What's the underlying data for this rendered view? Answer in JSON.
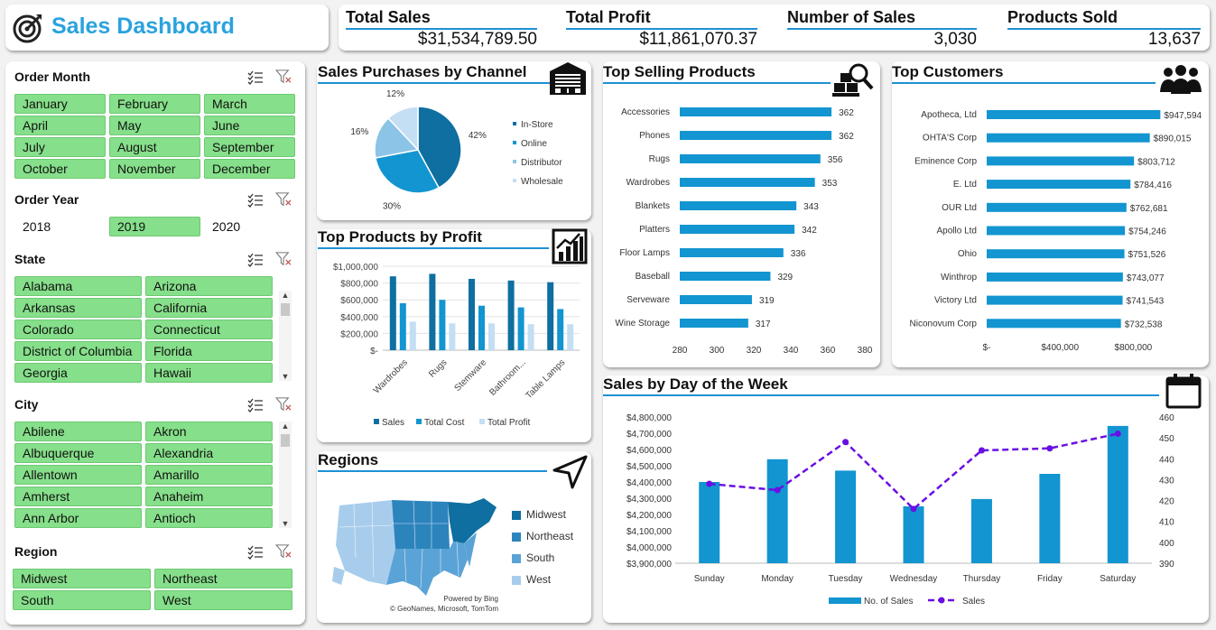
{
  "header": {
    "title": "Sales Dashboard"
  },
  "kpis": [
    {
      "label": "Total Sales",
      "value": "$31,534,789.50"
    },
    {
      "label": "Total Profit",
      "value": "$11,861,070.37"
    },
    {
      "label": "Number of Sales",
      "value": "3,030"
    },
    {
      "label": "Products Sold",
      "value": "13,637"
    }
  ],
  "slicers": {
    "order_month": {
      "title": "Order Month",
      "items": [
        "January",
        "February",
        "March",
        "April",
        "May",
        "June",
        "July",
        "August",
        "September",
        "October",
        "November",
        "December"
      ]
    },
    "order_year": {
      "title": "Order Year",
      "items": [
        "2018",
        "2019",
        "2020"
      ],
      "selected": "2019"
    },
    "state": {
      "title": "State",
      "items": [
        "Alabama",
        "Arizona",
        "Arkansas",
        "California",
        "Colorado",
        "Connecticut",
        "District of Columbia",
        "Florida",
        "Georgia",
        "Hawaii"
      ]
    },
    "city": {
      "title": "City",
      "items": [
        "Abilene",
        "Akron",
        "Albuquerque",
        "Alexandria",
        "Allentown",
        "Amarillo",
        "Amherst",
        "Anaheim",
        "Ann Arbor",
        "Antioch"
      ]
    },
    "region": {
      "title": "Region",
      "items": [
        "Midwest",
        "Northeast",
        "South",
        "West"
      ]
    }
  },
  "panels": {
    "channel": "Sales Purchases by Channel",
    "profit": "Top Products by Profit",
    "regions": "Regions",
    "products": "Top Selling Products",
    "customers": "Top Customers",
    "weekday": "Sales by Day of the Week"
  },
  "map": {
    "legend": [
      "Midwest",
      "Northeast",
      "South",
      "West"
    ],
    "credit1": "Powered by Bing",
    "credit2": "© GeoNames, Microsoft, TomTom"
  },
  "colors": {
    "dark": "#0e6fa0",
    "mid": "#1295d0",
    "light": "#8cc4e8",
    "pale": "#c4def3",
    "selected": "#86df8a",
    "accent": "#1e90d6",
    "purple": "#6a0fe3"
  },
  "chart_data": [
    {
      "type": "pie",
      "categories": [
        "In-Store",
        "Online",
        "Distributor",
        "Wholesale"
      ],
      "values": [
        42,
        30,
        16,
        12
      ],
      "labels": [
        "42%",
        "30%",
        "16%",
        "12%"
      ]
    },
    {
      "type": "bar",
      "categories": [
        "Wardrobes",
        "Rugs",
        "Stemware",
        "Bathroom...",
        "Table Lamps"
      ],
      "series": [
        {
          "name": "Sales",
          "values": [
            880000,
            910000,
            850000,
            830000,
            810000
          ]
        },
        {
          "name": "Total Cost",
          "values": [
            560000,
            600000,
            530000,
            510000,
            490000
          ]
        },
        {
          "name": "Total Profit",
          "values": [
            340000,
            320000,
            320000,
            310000,
            310000
          ]
        }
      ],
      "ylim": [
        0,
        1000000
      ],
      "yticks": [
        "$-",
        "$200,000",
        "$400,000",
        "$600,000",
        "$800,000",
        "$1,000,000"
      ],
      "legend": "bottom"
    },
    {
      "type": "bar",
      "orientation": "horizontal",
      "categories": [
        "Accessories",
        "Phones",
        "Rugs",
        "Wardrobes",
        "Blankets",
        "Platters",
        "Floor Lamps",
        "Baseball",
        "Serveware",
        "Wine Storage"
      ],
      "values": [
        362,
        362,
        356,
        353,
        343,
        342,
        336,
        329,
        319,
        317
      ],
      "xlim": [
        280,
        380
      ],
      "xticks": [
        "280",
        "300",
        "320",
        "340",
        "360",
        "380"
      ]
    },
    {
      "type": "bar",
      "orientation": "horizontal",
      "categories": [
        "Apotheca, Ltd",
        "OHTA'S Corp",
        "Eminence Corp",
        "E. Ltd",
        "OUR Ltd",
        "Apollo Ltd",
        "Ohio",
        "Winthrop",
        "Victory Ltd",
        "Niconovum Corp"
      ],
      "values": [
        947594,
        890015,
        803712,
        784416,
        762681,
        754246,
        751526,
        743077,
        741543,
        732538
      ],
      "labels": [
        "$947,594",
        "$890,015",
        "$803,712",
        "$784,416",
        "$762,681",
        "$754,246",
        "$751,526",
        "$743,077",
        "$741,543",
        "$732,538"
      ],
      "xlim": [
        0,
        1000000
      ],
      "xticks": [
        "$-",
        "$400,000",
        "$800,000"
      ]
    },
    {
      "type": "bar",
      "categories": [
        "Sunday",
        "Monday",
        "Tuesday",
        "Wednesday",
        "Thursday",
        "Friday",
        "Saturday"
      ],
      "series": [
        {
          "name": "No. of Sales",
          "type": "bar",
          "axis": "left",
          "values": [
            4400000,
            4540000,
            4470000,
            4250000,
            4295000,
            4450000,
            4745000
          ]
        },
        {
          "name": "Sales",
          "type": "line",
          "axis": "right",
          "values": [
            428,
            425,
            448,
            416,
            444,
            445,
            452
          ]
        }
      ],
      "ylim": [
        3900000,
        4800000
      ],
      "yticks": [
        "$3,900,000",
        "$4,000,000",
        "$4,100,000",
        "$4,200,000",
        "$4,300,000",
        "$4,400,000",
        "$4,500,000",
        "$4,600,000",
        "$4,700,000",
        "$4,800,000"
      ],
      "y2lim": [
        390,
        460
      ],
      "y2ticks": [
        "390",
        "400",
        "410",
        "420",
        "430",
        "440",
        "450",
        "460"
      ],
      "legend": "bottom"
    }
  ]
}
